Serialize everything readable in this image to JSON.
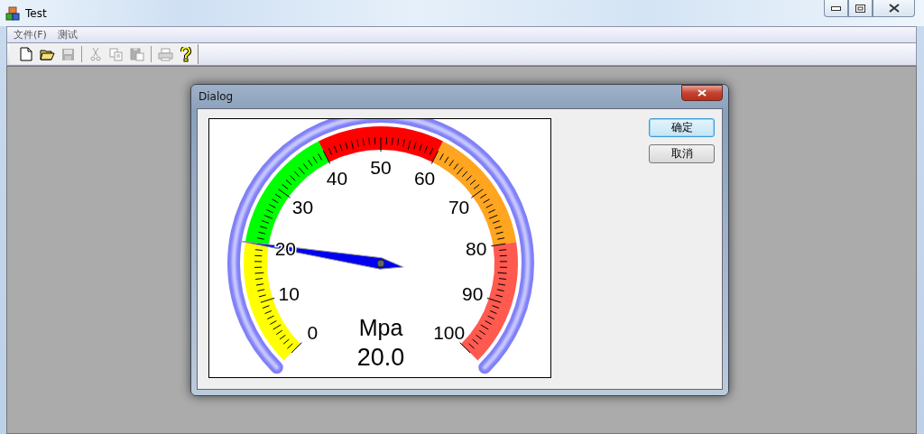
{
  "window": {
    "title": "Test"
  },
  "menu": [
    {
      "label": "文件(F)"
    },
    {
      "label": "测试"
    }
  ],
  "toolbar": [
    {
      "kind": "new",
      "disabled": false
    },
    {
      "kind": "open",
      "disabled": false
    },
    {
      "kind": "save",
      "disabled": true
    },
    {
      "kind": "separator"
    },
    {
      "kind": "cut",
      "disabled": true
    },
    {
      "kind": "copy",
      "disabled": true
    },
    {
      "kind": "paste",
      "disabled": true
    },
    {
      "kind": "separator"
    },
    {
      "kind": "print",
      "disabled": true
    },
    {
      "kind": "help",
      "disabled": false
    }
  ],
  "dialog": {
    "title": "Dialog",
    "gauge": {
      "level": 0.2,
      "unit": "Mpa",
      "reading": "20.0",
      "tick_labels": [
        "0",
        "10",
        "20",
        "30",
        "40",
        "50",
        "60",
        "70",
        "80",
        "90",
        "100"
      ],
      "bands": [
        {
          "color": "#ffff00"
        },
        {
          "color": "#00ff00"
        },
        {
          "color": "#ff0000"
        },
        {
          "color": "#ffa520"
        },
        {
          "color": "#ff5a50"
        }
      ]
    },
    "buttons": [
      {
        "label": "确定",
        "default": true
      },
      {
        "label": "取消",
        "default": false
      }
    ]
  }
}
